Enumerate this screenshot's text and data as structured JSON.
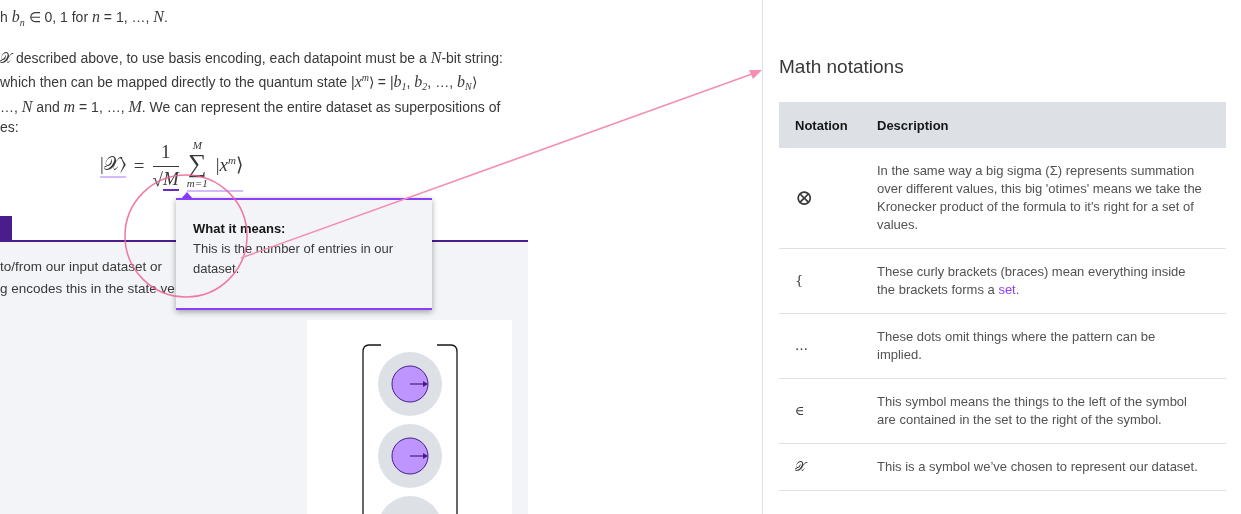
{
  "article": {
    "paragraphs": [
      [
        "h *b*$_{n}$ ∈ 0, 1 for *n* = 1, …, *N*."
      ],
      [
        "𝒳 described above, to use basis encoding, each datapoint must be a *N*-bit string:",
        "which then can be mapped directly to the quantum state |*x*$^{m}$⟩ = |*b*$_{1}$, *b*$_{2}$, …, *b*$_{N}$⟩",
        "…, *N* and *m* = 1, …, *M*. We can represent the entire dataset as superpositions of",
        "es:"
      ]
    ],
    "formula": [
      {
        "kind": "ket",
        "text": "|𝒳⟩",
        "active": false
      },
      {
        "kind": "op",
        "text": "="
      },
      {
        "kind": "frac",
        "numerator": "1",
        "radical": "√",
        "denominator": "M",
        "active": true
      },
      {
        "kind": "sum",
        "upper": "M",
        "symbol": "∑",
        "lower": "m=1",
        "body": "|*x*$^{m}$⟩",
        "active": false
      }
    ],
    "panel": {
      "lines": [
        "to/from our input dataset or",
        "g encodes this in the state ve"
      ]
    },
    "tooltip": {
      "title": "What it means:",
      "body": "This is the number of entries in our dataset."
    }
  },
  "sidebar": {
    "title": "Math notations",
    "columns": [
      "Notation",
      "Description"
    ],
    "rows": [
      {
        "notation": "⊗",
        "large": true,
        "description": "In the same way a big sigma (Σ) represents summation over different values, this big 'otimes' means we take the Kronecker product of the formula to it's right for a set of values."
      },
      {
        "notation": "{",
        "large": false,
        "description": "These curly brackets (braces) mean everything inside the brackets forms a ",
        "link": "set",
        "after": "."
      },
      {
        "notation": "…",
        "large": false,
        "description": "These dots omit things where the pattern can be implied."
      },
      {
        "notation": "∈",
        "large": false,
        "description": "This symbol means the things to the left of the symbol are contained in the set to the right of the symbol."
      },
      {
        "notation": "𝒳",
        "large": false,
        "description": "This is a symbol we’ve chosen to represent our dataset."
      }
    ]
  }
}
